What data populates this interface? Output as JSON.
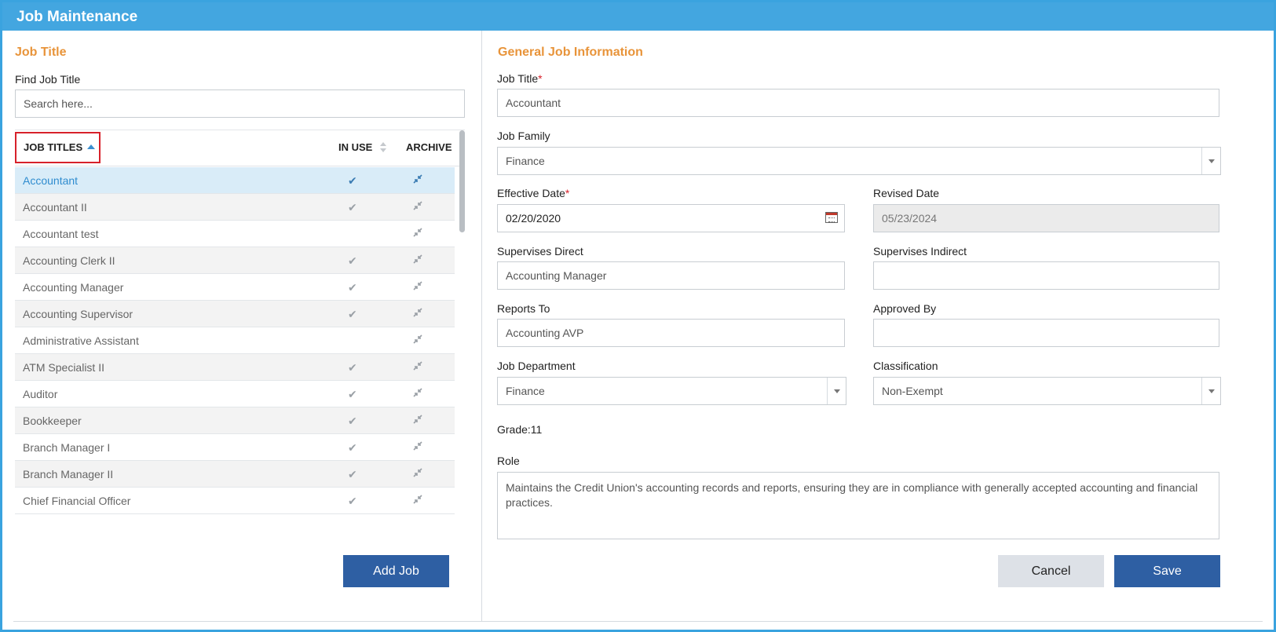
{
  "window": {
    "title": "Job Maintenance"
  },
  "left": {
    "section_title": "Job Title",
    "find_label": "Find Job Title",
    "search_placeholder": "Search here...",
    "columns": {
      "job_titles": "JOB TITLES",
      "in_use": "IN USE",
      "archive": "ARCHIVE"
    },
    "sort": {
      "column": "job_titles",
      "direction": "ascending"
    },
    "rows": [
      {
        "name": "Accountant",
        "in_use": true,
        "selected": true
      },
      {
        "name": "Accountant II",
        "in_use": true
      },
      {
        "name": "Accountant test",
        "in_use": false
      },
      {
        "name": "Accounting Clerk II",
        "in_use": true
      },
      {
        "name": "Accounting Manager",
        "in_use": true
      },
      {
        "name": "Accounting Supervisor",
        "in_use": true
      },
      {
        "name": "Administrative Assistant",
        "in_use": false
      },
      {
        "name": "ATM Specialist II",
        "in_use": true
      },
      {
        "name": "Auditor",
        "in_use": true
      },
      {
        "name": "Bookkeeper",
        "in_use": true
      },
      {
        "name": "Branch Manager I",
        "in_use": true
      },
      {
        "name": "Branch Manager II",
        "in_use": true
      },
      {
        "name": "Chief Financial Officer",
        "in_use": true
      }
    ],
    "add_button": "Add Job"
  },
  "right": {
    "section_title": "General Job Information",
    "job_title": {
      "label": "Job Title",
      "required_mark": "*",
      "value": "Accountant"
    },
    "job_family": {
      "label": "Job Family",
      "value": "Finance"
    },
    "effective_date": {
      "label": "Effective Date",
      "required_mark": "*",
      "value": "02/20/2020"
    },
    "revised_date": {
      "label": "Revised Date",
      "value": "05/23/2024"
    },
    "supervises_direct": {
      "label": "Supervises Direct",
      "value": "Accounting Manager"
    },
    "supervises_indirect": {
      "label": "Supervises Indirect",
      "value": ""
    },
    "reports_to": {
      "label": "Reports To",
      "value": "Accounting AVP"
    },
    "approved_by": {
      "label": "Approved By",
      "value": ""
    },
    "job_department": {
      "label": "Job Department",
      "value": "Finance"
    },
    "classification": {
      "label": "Classification",
      "value": "Non-Exempt"
    },
    "grade": "Grade:11",
    "role": {
      "label": "Role",
      "value": "Maintains the Credit Union's accounting records and reports, ensuring they are in compliance with generally accepted accounting and financial practices."
    },
    "cancel_button": "Cancel",
    "save_button": "Save"
  },
  "icons": {
    "in_use": "check-icon",
    "archive": "archive-compress-icon",
    "date_picker": "calendar-icon",
    "dropdown": "chevron-down-icon"
  },
  "colors": {
    "accent": "#43a6e0",
    "section_title": "#e8943a",
    "primary_button": "#2e5fa3",
    "selected_row": "#d9ecf8",
    "required": "#d7212a"
  }
}
